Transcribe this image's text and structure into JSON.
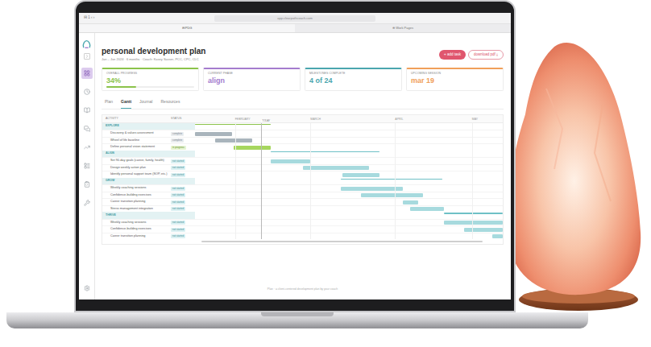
{
  "browser": {
    "controls": "⊟ 1 ‹ ›",
    "url": "app.clearpathcoach.com",
    "tabs": [
      {
        "label": "⊟ PDG",
        "selected": true
      },
      {
        "label": "⊕ Work Pages",
        "selected": false
      }
    ]
  },
  "sidebar": {
    "items": [
      {
        "selected": true
      },
      {
        "selected": false
      },
      {
        "selected": false
      },
      {
        "selected": false
      },
      {
        "selected": false
      },
      {
        "selected": false
      },
      {
        "selected": false
      },
      {
        "selected": false
      }
    ]
  },
  "page": {
    "title": "personal development plan",
    "subtitle": "Jan – Jun 2024 · 6 months · Coach: Kasey Sasser, PCC, CPC, CLC",
    "buttons": [
      {
        "label": "+ add task",
        "kind": "primary"
      },
      {
        "label": "download pdf ⤓",
        "kind": "outline"
      }
    ]
  },
  "cards": [
    {
      "label": "OVERALL PROGRESS",
      "value": "34%",
      "color": "#8bc34a",
      "level": 0.34
    },
    {
      "label": "CURRENT PHASE",
      "value": "align",
      "color": "#a47cce"
    },
    {
      "label": "MILESTONES COMPLETE",
      "value": "4 of 24",
      "color": "#4aa6ae"
    },
    {
      "label": "UPCOMING SESSION",
      "value": "mar 19",
      "color": "#f0a05a"
    }
  ],
  "tabs": [
    {
      "label": "Plan",
      "selected": false
    },
    {
      "label": "Gantt",
      "selected": true
    },
    {
      "label": "Journal",
      "selected": false
    },
    {
      "label": "Resources",
      "selected": false
    }
  ],
  "gantt": {
    "columns": [
      "ACTIVITY",
      "STATUS"
    ],
    "span_weeks": 20,
    "months": [
      {
        "label": "FEBRUARY",
        "week": 2.6
      },
      {
        "label": "MARCH",
        "week": 7.5
      },
      {
        "label": "APRIL",
        "week": 13
      },
      {
        "label": "MAY",
        "week": 18
      }
    ],
    "today": {
      "label": "TODAY",
      "week": 4.3
    },
    "groups": [
      {
        "name": "EXPLORE",
        "color": "#8bc34a",
        "start": 0,
        "end": 4.9,
        "tasks": [
          {
            "name": "Discovery & values assessment",
            "status": "complete",
            "start": 0,
            "end": 2.4,
            "color": "#a9b4bc"
          },
          {
            "name": "Wheel of life baseline",
            "status": "complete",
            "start": 1.3,
            "end": 3.7,
            "color": "#a9b4bc"
          },
          {
            "name": "Define personal vision statement",
            "status": "in progress",
            "start": 2.5,
            "end": 4.9,
            "color": "#a6d65e"
          }
        ]
      },
      {
        "name": "ALIGN",
        "color": "#6fc0c6",
        "start": 4.9,
        "end": 12,
        "tasks": [
          {
            "name": "Set 90-day goals (career, family, health)",
            "status": "not started",
            "start": 4.9,
            "end": 7.5,
            "color": "#a7dade"
          },
          {
            "name": "Design weekly action plan",
            "status": "not started",
            "start": 7,
            "end": 11.3,
            "color": "#a7dade"
          },
          {
            "name": "Identify personal support team (SOP, etc.)",
            "status": "not started",
            "start": 9.6,
            "end": 12,
            "color": "#a7dade"
          }
        ]
      },
      {
        "name": "GROW",
        "color": "#6fc0c6",
        "start": 9.5,
        "end": 16.1,
        "tasks": [
          {
            "name": "Weekly coaching sessions",
            "status": "not started",
            "start": 9.5,
            "end": 13.5,
            "color": "#a7dade"
          },
          {
            "name": "Confidence-building exercises",
            "status": "not started",
            "start": 10.8,
            "end": 14.8,
            "color": "#a7dade"
          },
          {
            "name": "Career transition planning",
            "status": "not started",
            "start": 13.5,
            "end": 14.5,
            "color": "#a7dade"
          },
          {
            "name": "Stress management integration",
            "status": "not started",
            "start": 14,
            "end": 16.2,
            "color": "#a7dade"
          }
        ]
      },
      {
        "name": "THRIVE",
        "color": "#6fc0c6",
        "start": 16.2,
        "end": 20,
        "tasks": [
          {
            "name": "Weekly coaching sessions",
            "status": "not started",
            "start": 16.2,
            "end": 20,
            "color": "#a7dade"
          },
          {
            "name": "Confidence-building exercises",
            "status": "not started",
            "start": 17.5,
            "end": 20,
            "color": "#a7dade"
          },
          {
            "name": "Career transition planning",
            "status": "not started",
            "start": 19.3,
            "end": 20,
            "color": "#a7dade"
          }
        ]
      }
    ]
  },
  "footer": "Plan · a client-centered development plan by your coach"
}
